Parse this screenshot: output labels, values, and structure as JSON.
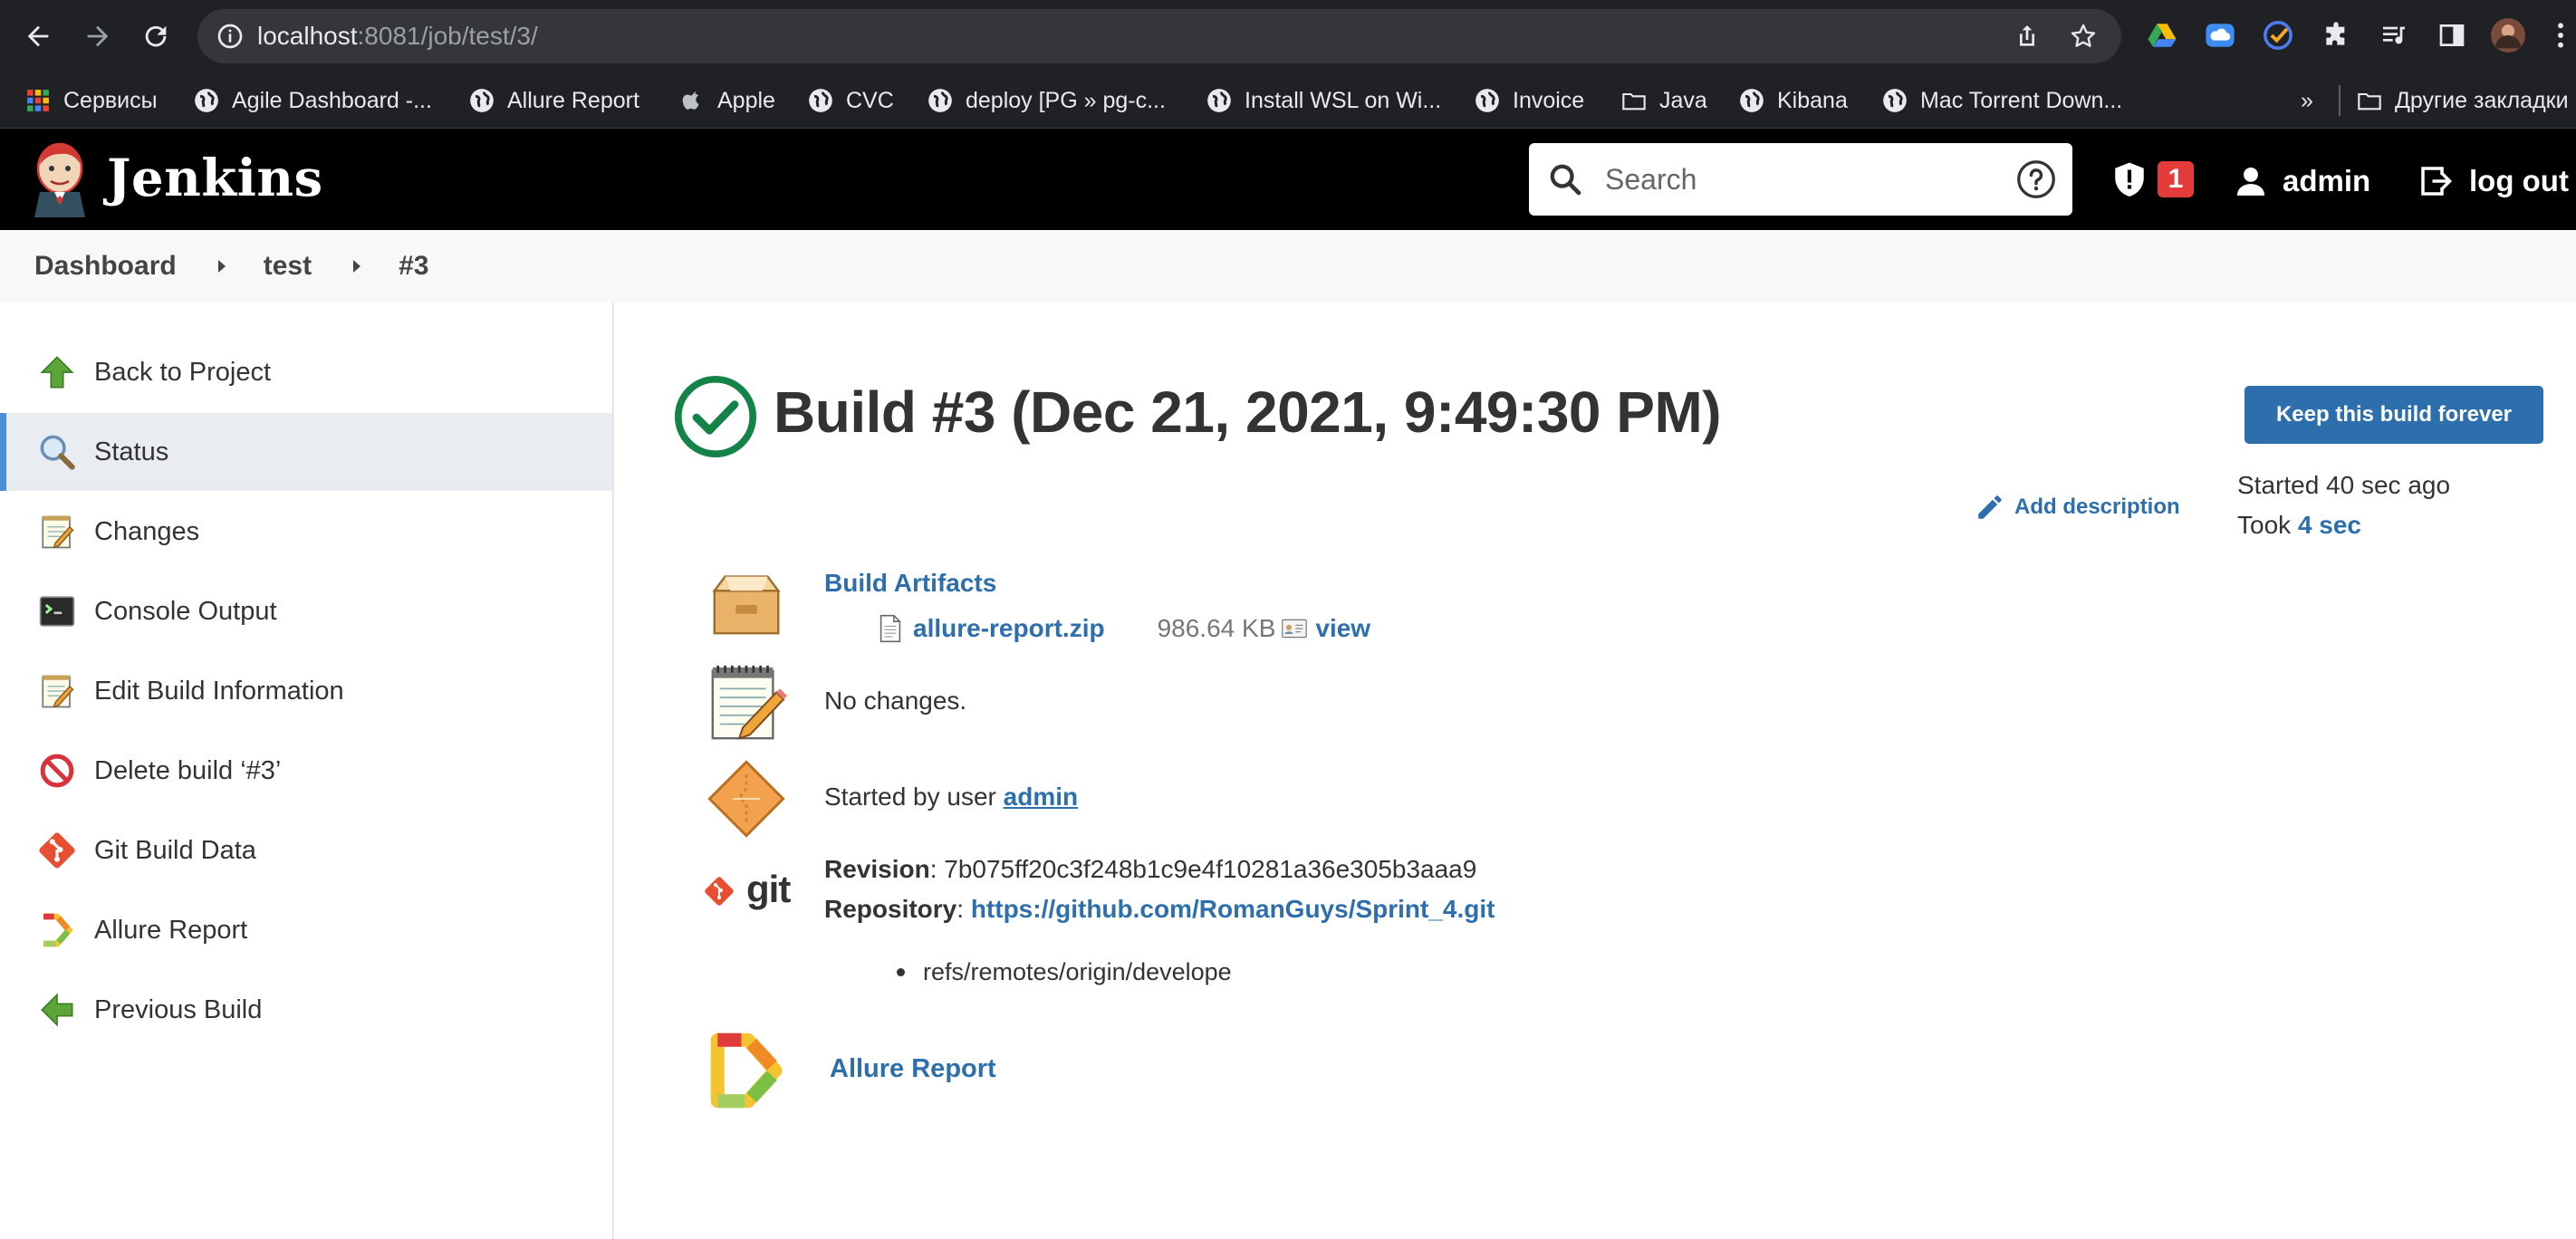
{
  "browser": {
    "url_host": "localhost",
    "url_rest": ":8081/job/test/3/",
    "bookmarks": [
      {
        "label": "Сервисы",
        "icon": "apps-grid-icon"
      },
      {
        "label": "Agile Dashboard -...",
        "icon": "globe-icon"
      },
      {
        "label": "Allure Report",
        "icon": "globe-icon"
      },
      {
        "label": "Apple",
        "icon": "apple-icon"
      },
      {
        "label": "CVC",
        "icon": "globe-icon"
      },
      {
        "label": "deploy [PG » pg-c...",
        "icon": "globe-icon"
      },
      {
        "label": "Install WSL on Wi...",
        "icon": "globe-icon"
      },
      {
        "label": "Invoice",
        "icon": "globe-icon"
      },
      {
        "label": "Java",
        "icon": "folder-icon"
      },
      {
        "label": "Kibana",
        "icon": "globe-icon"
      },
      {
        "label": "Mac Torrent Down...",
        "icon": "globe-icon"
      }
    ],
    "overflow_label": "»",
    "other_bookmarks": "Другие закладки"
  },
  "header": {
    "app_title": "Jenkins",
    "search_placeholder": "Search",
    "alert_count": "1",
    "user": "admin",
    "logout": "log out"
  },
  "breadcrumbs": [
    "Dashboard",
    "test",
    "#3"
  ],
  "sidebar": {
    "items": [
      {
        "label": "Back to Project",
        "icon": "up-arrow-icon"
      },
      {
        "label": "Status",
        "icon": "magnifier-icon",
        "active": true
      },
      {
        "label": "Changes",
        "icon": "notepad-icon"
      },
      {
        "label": "Console Output",
        "icon": "terminal-icon"
      },
      {
        "label": "Edit Build Information",
        "icon": "notepad-icon"
      },
      {
        "label": "Delete build ‘#3’",
        "icon": "no-entry-icon"
      },
      {
        "label": "Git Build Data",
        "icon": "git-icon"
      },
      {
        "label": "Allure Report",
        "icon": "allure-icon"
      },
      {
        "label": "Previous Build",
        "icon": "left-arrow-icon"
      }
    ]
  },
  "main": {
    "title": "Build #3 (Dec 21, 2021, 9:49:30 PM)",
    "keep_button": "Keep this build forever",
    "add_description": "Add description",
    "started": "Started 40 sec ago",
    "took_prefix": "Took",
    "took_value": "4 sec",
    "artifacts_title": "Build Artifacts",
    "artifact_name": "allure-report.zip",
    "artifact_size": "986.64 KB",
    "artifact_view": "view",
    "changes": "No changes.",
    "started_by_prefix": "Started by user",
    "started_by_user": "admin",
    "revision_label": "Revision",
    "revision_value": ": 7b075ff20c3f248b1c9e4f10281a36e305b3aaa9",
    "repository_label": "Repository",
    "repository_sep": ": ",
    "repository_url": "https://github.com/RomanGuys/Sprint_4.git",
    "branch": "refs/remotes/origin/develope",
    "allure_link": "Allure Report",
    "git_logo_text": "git"
  },
  "colors": {
    "link": "#2d6fac",
    "success": "#138347",
    "badge": "#e43b3b",
    "active_bar": "#4a90d9"
  }
}
